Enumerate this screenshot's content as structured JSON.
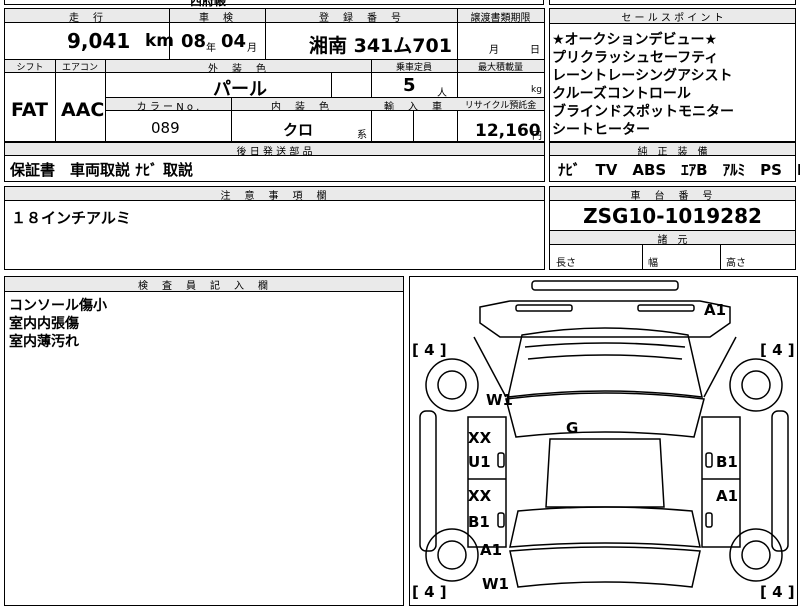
{
  "top_strip": {
    "cut_text": "西府帳"
  },
  "mileage": {
    "header": "走　行",
    "value": "9,041",
    "unit": "km"
  },
  "inspection": {
    "header": "車　検",
    "year": "08",
    "year_unit": "年",
    "month": "04",
    "month_unit": "月"
  },
  "registration": {
    "header": "登　録　番　号",
    "value": "湘南 341ム701"
  },
  "transfer_deadline": {
    "header": "譲渡書類期限",
    "month_unit": "月",
    "day_unit": "日"
  },
  "shift": {
    "header": "シフト",
    "value": "FAT"
  },
  "aircon": {
    "header": "エアコン",
    "value": "AAC"
  },
  "exterior_color": {
    "header": "外　装　色",
    "value": "パール"
  },
  "capacity": {
    "header": "乗車定員",
    "value": "5",
    "unit": "人"
  },
  "max_load": {
    "header": "最大積載量",
    "unit": "kg"
  },
  "color_no": {
    "header": "カ ラ ー N o .",
    "value": "089"
  },
  "interior_color": {
    "header": "内　装　色",
    "value": "クロ",
    "suffix": "系"
  },
  "import": {
    "header": "輸　入　車"
  },
  "recycle": {
    "header": "リサイクル預託金",
    "value": "12,160",
    "unit": "円"
  },
  "later_parts": {
    "header": "後 日 発 送 部 品",
    "value": "保証書　車両取説 ﾅﾋﾞ 取説"
  },
  "sales_points": {
    "header": "セ ー ル ス ポ イ ン ト",
    "items": [
      "★オークションデビュー★",
      "プリクラッシュセーフティ",
      "レーントレーシングアシスト",
      "クルーズコントロール",
      "ブラインドスポットモニター",
      "シートヒーター"
    ]
  },
  "equipment": {
    "header": "純　正　装　備",
    "value": "ﾅﾋﾞ　TV　ABS　ｴｱB　ｱﾙﾐ　PS　PW"
  },
  "notes": {
    "header": "注　意　事　項　欄",
    "value": "１８インチアルミ"
  },
  "chassis": {
    "header": "車　台　番　号",
    "value": "ZSG10-1019282"
  },
  "dimensions": {
    "header": "諸　元",
    "length": "長さ",
    "width": "幅",
    "height": "高さ"
  },
  "inspector": {
    "header": "検　査　員　記　入　欄",
    "lines": [
      "コンソール傷小",
      "室内内張傷",
      "室内薄汚れ"
    ]
  },
  "diagram_marks": {
    "tire_fl": "[ 4 ]",
    "tire_fr": "[ 4 ]",
    "tire_rl": "[ 4 ]",
    "tire_rr": "[ 4 ]",
    "a1_top": "A1",
    "w1_front": "W1",
    "g_roof": "G",
    "xx_left_front": "XX",
    "u1_left_front": "U1",
    "xx_left_rear": "XX",
    "b1_left_rear": "B1",
    "b1_right_front": "B1",
    "a1_right_rear": "A1",
    "a1_left_bottom": "A1",
    "w1_rear": "W1"
  }
}
